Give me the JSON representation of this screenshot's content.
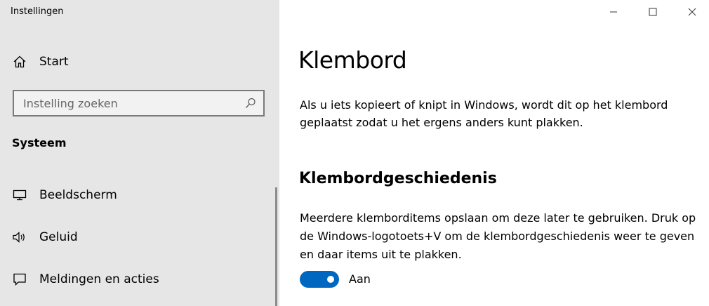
{
  "window": {
    "title": "Instellingen"
  },
  "sidebar": {
    "home_label": "Start",
    "search_placeholder": "Instelling zoeken",
    "section_heading": "Systeem",
    "items": [
      {
        "label": "Beeldscherm",
        "icon": "monitor-icon"
      },
      {
        "label": "Geluid",
        "icon": "speaker-icon"
      },
      {
        "label": "Meldingen en acties",
        "icon": "message-icon"
      }
    ]
  },
  "main": {
    "title": "Klembord",
    "description": "Als u iets kopieert of knipt in Windows, wordt dit op het klembord geplaatst zodat u het ergens anders kunt plakken.",
    "history": {
      "heading": "Klembordgeschiedenis",
      "description": "Meerdere klembord­items opslaan om deze later te gebruiken. Druk op de Windows-logotoets+V om de klembordgeschiedenis weer te geven en daar items uit te plakken.",
      "toggle_state": "Aan",
      "toggle_on": true
    }
  },
  "colors": {
    "accent": "#0067c0",
    "sidebar_bg": "#e6e6e6"
  }
}
